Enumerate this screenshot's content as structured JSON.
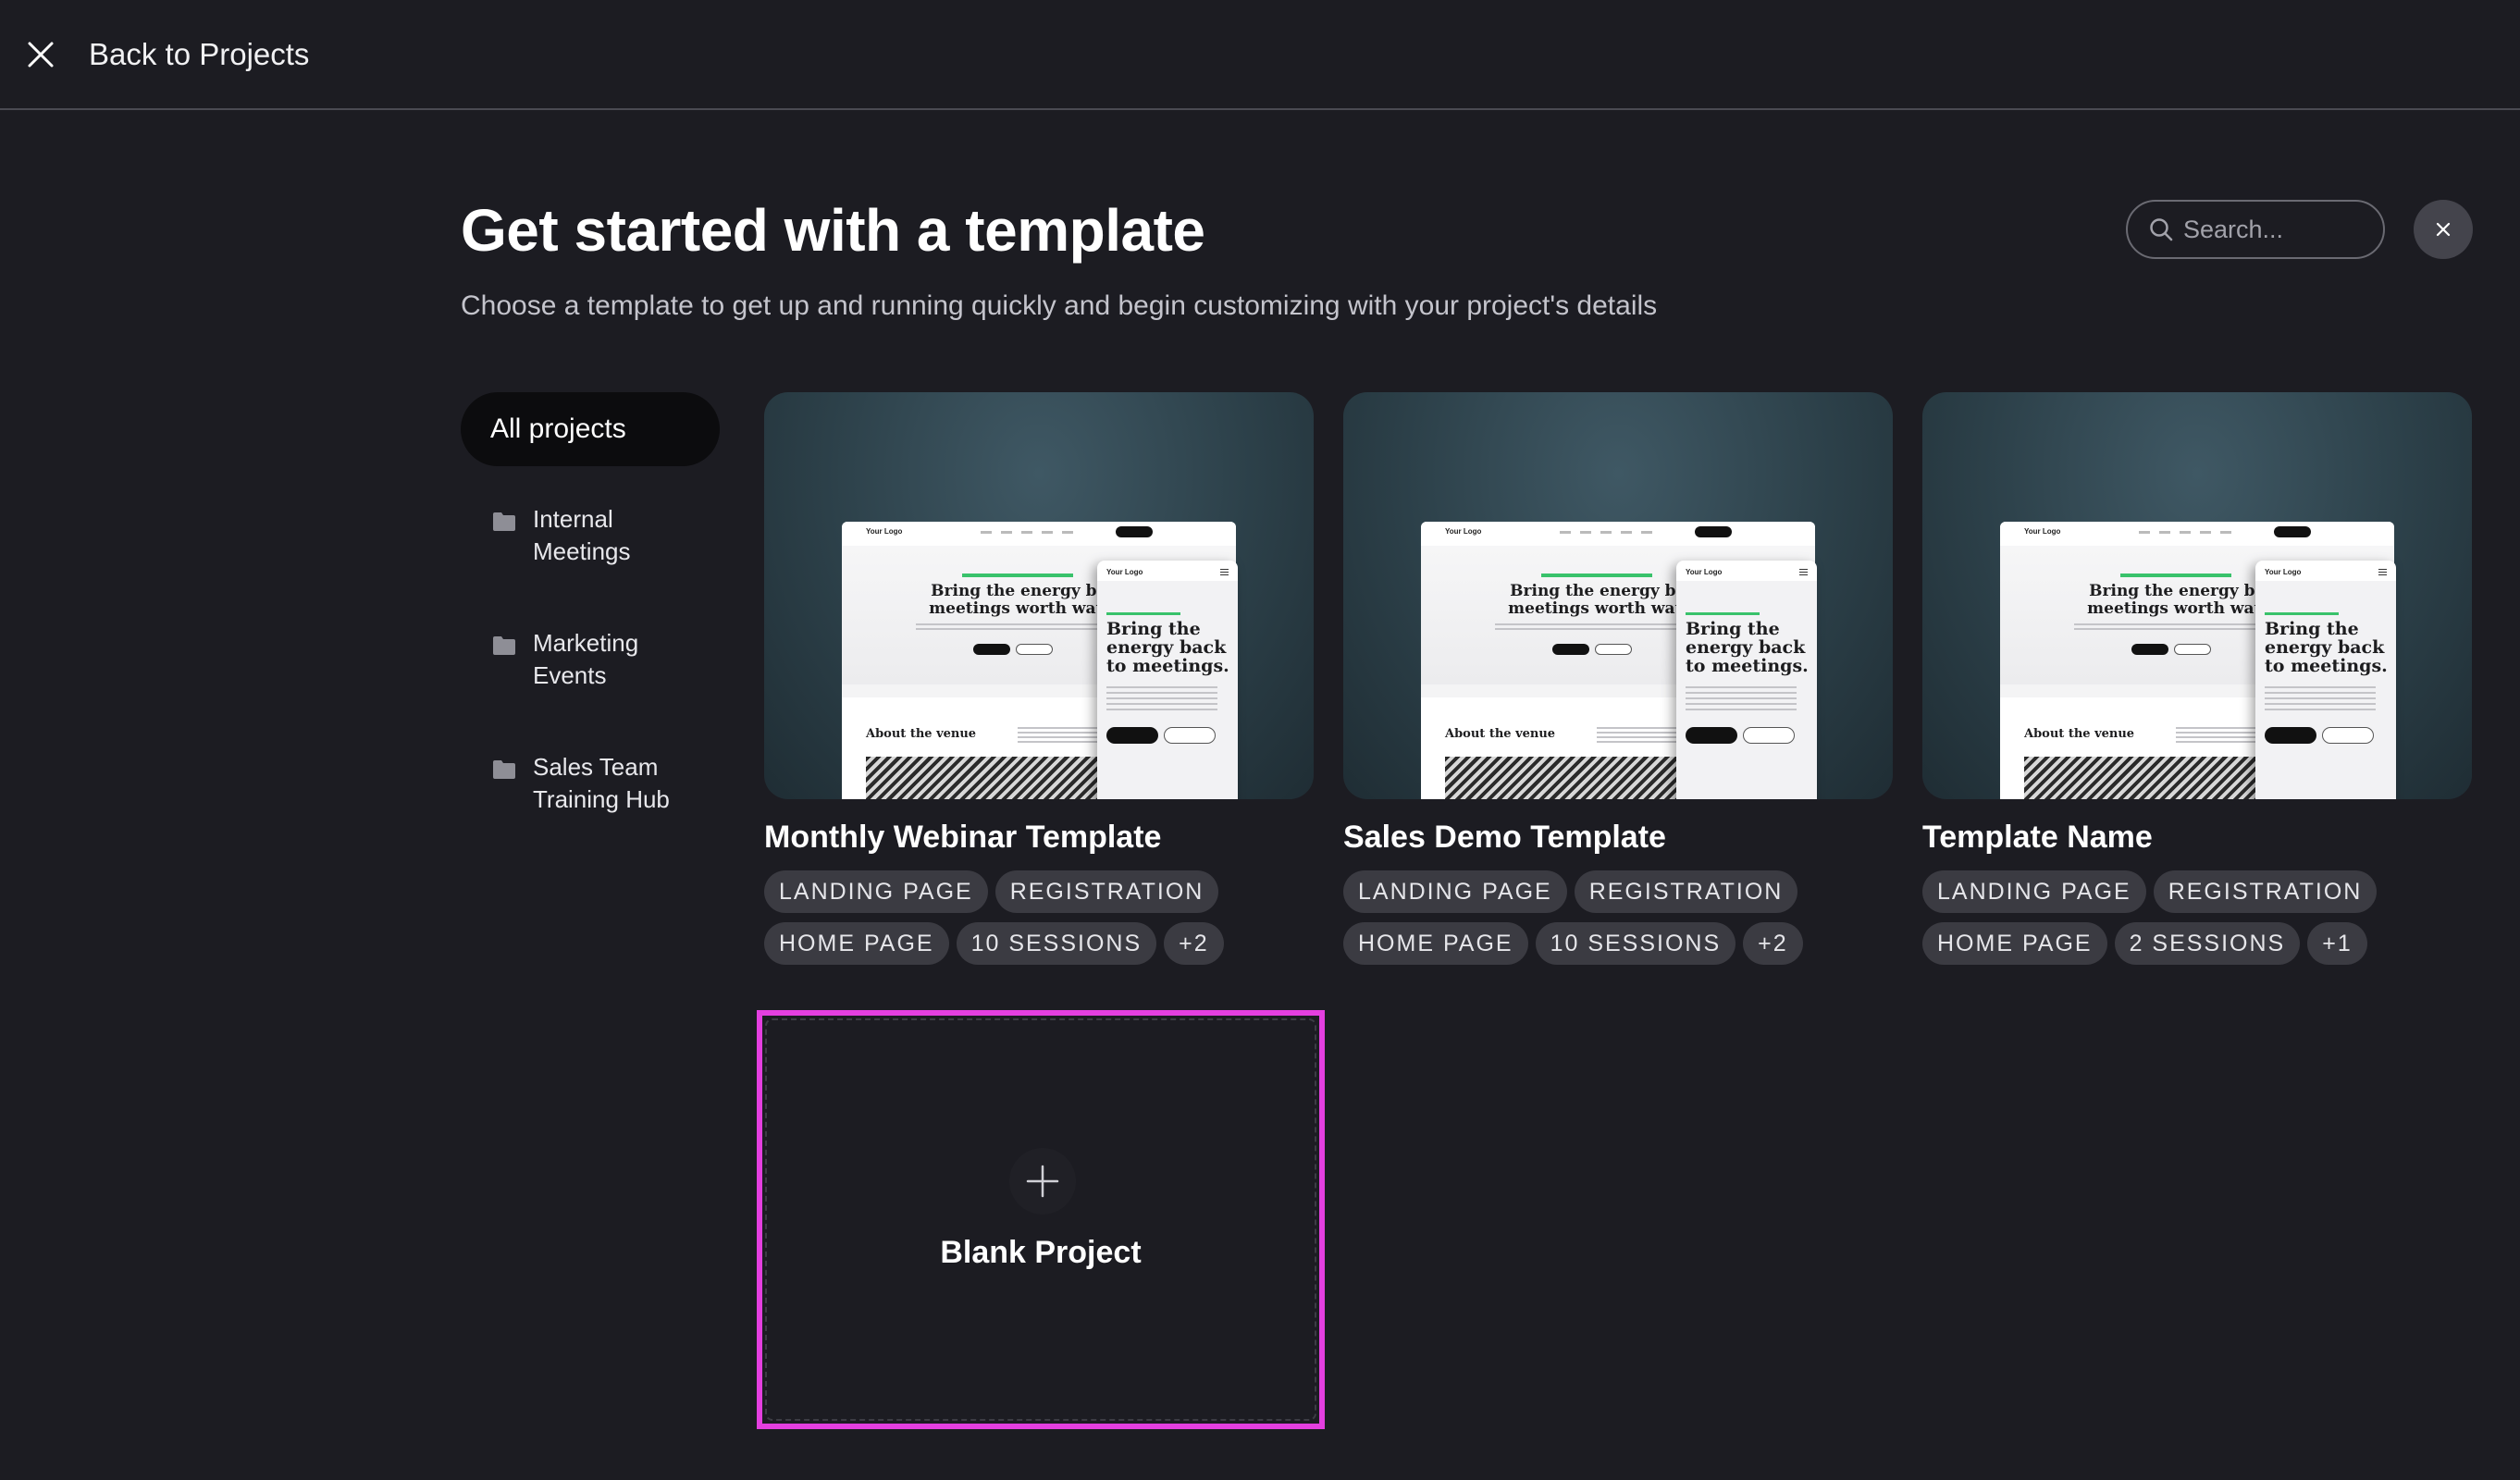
{
  "header": {
    "back_label": "Back to Projects"
  },
  "page": {
    "title": "Get started with a template",
    "subtitle": "Choose a template to get up and running quickly and begin customizing with your project's details"
  },
  "search": {
    "placeholder": "Search..."
  },
  "sidebar": {
    "all_label": "All projects",
    "items": [
      {
        "label": "Internal Meetings",
        "icon": "folder-icon"
      },
      {
        "label": "Marketing Events",
        "icon": "folder-icon"
      },
      {
        "label": "Sales Team Training Hub",
        "icon": "folder-icon"
      }
    ]
  },
  "preview": {
    "logo": "Your Logo",
    "desktop_headline": "Bring the energy back to meetings worth watching",
    "mobile_headline": "Bring the energy back to meetings.",
    "section_heading": "About the venue"
  },
  "templates": [
    {
      "name": "Monthly Webinar Template",
      "tags": [
        "LANDING PAGE",
        "REGISTRATION",
        "HOME PAGE",
        "10 SESSIONS",
        "+2"
      ]
    },
    {
      "name": "Sales Demo Template",
      "tags": [
        "LANDING PAGE",
        "REGISTRATION",
        "HOME PAGE",
        "10 SESSIONS",
        "+2"
      ]
    },
    {
      "name": "Template Name",
      "tags": [
        "LANDING PAGE",
        "REGISTRATION",
        "HOME PAGE",
        "2 SESSIONS",
        "+1"
      ]
    }
  ],
  "blank": {
    "label": "Blank Project",
    "highlight_color": "#e43fe0"
  },
  "colors": {
    "background": "#1c1c22",
    "tag_background": "#3b3b42",
    "accent_green": "#39c26b"
  }
}
